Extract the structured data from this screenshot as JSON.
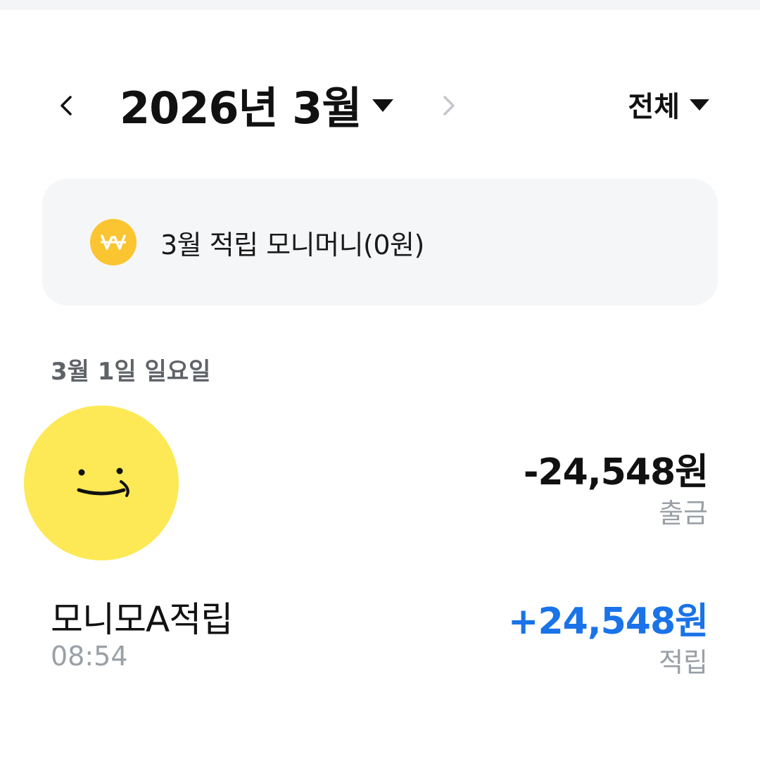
{
  "header": {
    "month_label": "2026년 3월",
    "filter_label": "전체"
  },
  "savings_card": {
    "text": "3월 적립 모니머니(0원)",
    "icon": "won-coin-icon",
    "icon_color": "#fbc531"
  },
  "date_group": {
    "label": "3월 1일 일요일"
  },
  "transaction": {
    "name": "모니모A적립",
    "time": "08:54",
    "withdrawal_amount": "-24,548원",
    "withdrawal_type": "출금",
    "deposit_amount": "+24,548원",
    "deposit_type": "적립",
    "avatar": "smiley-face-icon",
    "avatar_color": "#fce955",
    "deposit_color": "#1a73e8"
  }
}
